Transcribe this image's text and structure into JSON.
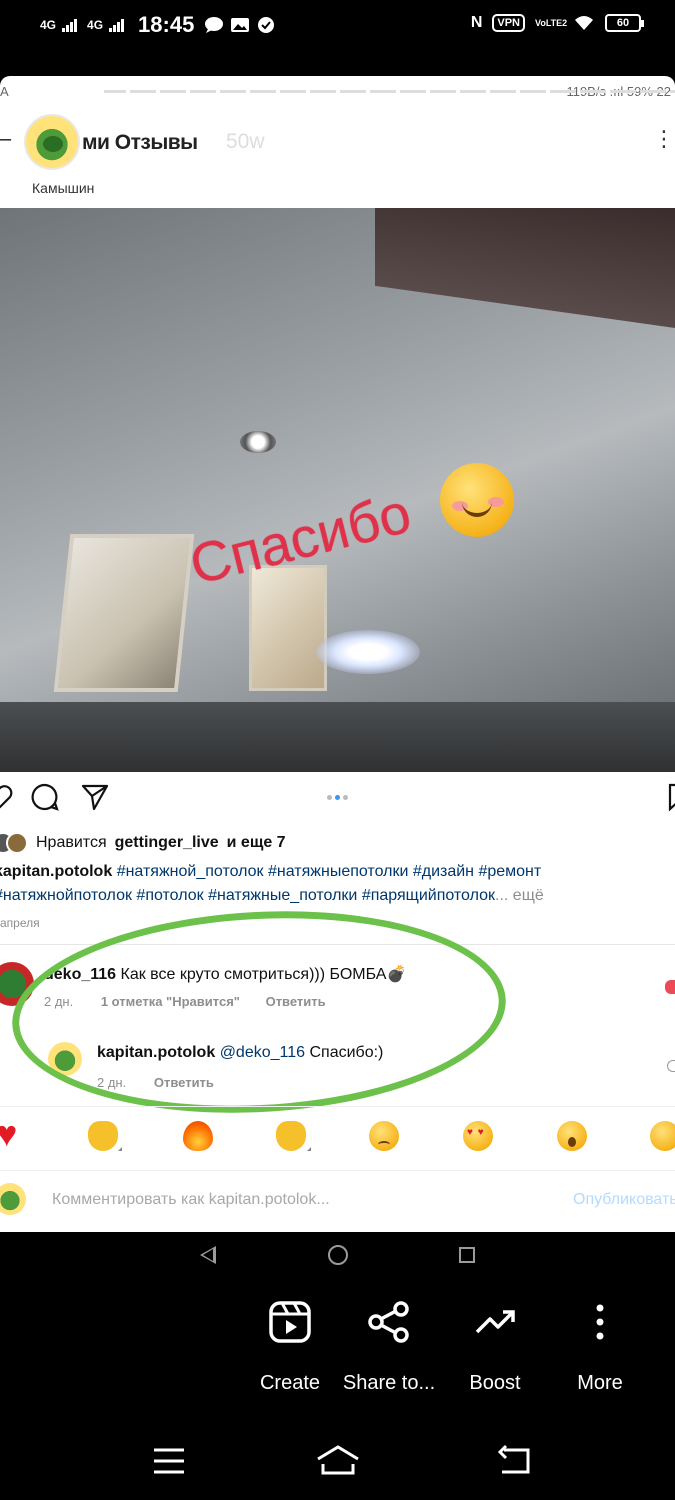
{
  "status_bar": {
    "network_1": "4G",
    "network_2": "4G",
    "time": "18:45",
    "nfc": "N",
    "vpn": "VPN",
    "volte": "VoLTE2",
    "battery": "60"
  },
  "inner_status": {
    "left": "A",
    "right": "119B/s  .ııl 59%  22"
  },
  "post": {
    "account_title": "ми Отзывы",
    "age": "50w",
    "location": "Камышин",
    "sticker_text": "Спасибо",
    "likes_prefix": "Нравится",
    "likes_user": "gettinger_live",
    "likes_suffix": "и еще 7",
    "caption_user": "kapitan.potolok",
    "caption_tags": "#натяжной_потолок #натяжныепотолки #дизайн #ремонт #натяжнойпотолок #потолок #натяжные_потолки #парящийпотолок",
    "caption_more": "... ещё",
    "date": "апреля"
  },
  "comments": [
    {
      "user": "deko_116",
      "text": "Как все круто смотриться))) БОМБА💣",
      "time": "2 дн.",
      "likes": "1 отметка \"Нравится\"",
      "reply": "Ответить"
    },
    {
      "user": "kapitan.potolok",
      "mention": "@deko_116",
      "text": "Спасибо:)",
      "time": "2 дн.",
      "reply": "Ответить"
    }
  ],
  "emoji_bar": [
    "heart",
    "raised-hands",
    "fire",
    "clap",
    "crying",
    "heart-eyes",
    "surprised",
    "laughing"
  ],
  "comment_box": {
    "placeholder": "Комментировать как kapitan.potolok...",
    "post_label": "Опубликовать"
  },
  "bottom_actions": {
    "create": "Create",
    "share": "Share to...",
    "boost": "Boost",
    "more": "More"
  }
}
